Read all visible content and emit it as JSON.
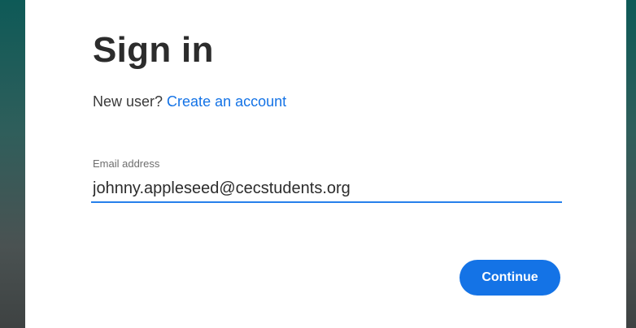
{
  "colors": {
    "accent": "#1473e6",
    "input_underline": "#2680eb",
    "background_panel": "#0e5a57"
  },
  "signin": {
    "title": "Sign in",
    "new_user_prompt": "New user?",
    "create_account_link": "Create an account",
    "email_label": "Email address",
    "email_value": "johnny.appleseed@cecstudents.org",
    "continue_label": "Continue"
  }
}
